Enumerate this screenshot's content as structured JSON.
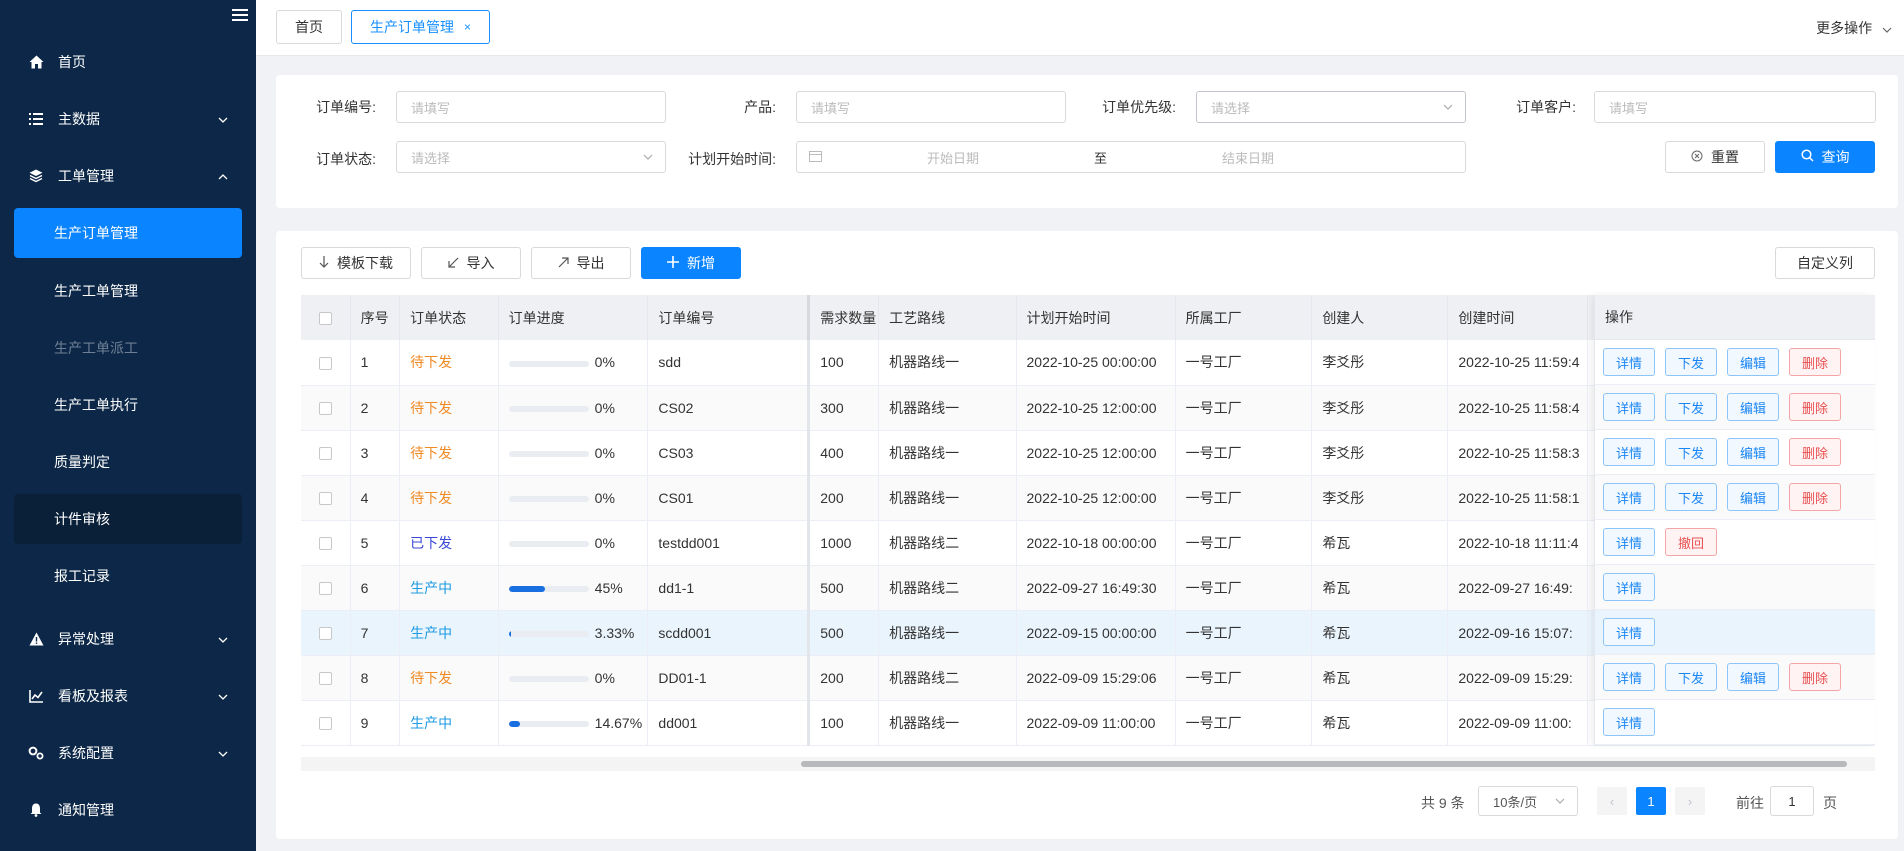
{
  "sidebar": {
    "menu": [
      {
        "label": "首页",
        "icon": "home-icon"
      },
      {
        "label": "主数据",
        "icon": "list-icon"
      },
      {
        "label": "工单管理",
        "icon": "layers-icon"
      },
      {
        "label": "异常处理",
        "icon": "warning-icon"
      },
      {
        "label": "看板及报表",
        "icon": "chart-icon"
      },
      {
        "label": "系统配置",
        "icon": "gears-icon"
      },
      {
        "label": "通知管理",
        "icon": "bell-icon"
      }
    ],
    "submenu": [
      {
        "label": "生产订单管理",
        "state": "active"
      },
      {
        "label": "生产工单管理",
        "state": "normal"
      },
      {
        "label": "生产工单派工",
        "state": "disabled"
      },
      {
        "label": "生产工单执行",
        "state": "normal"
      },
      {
        "label": "质量判定",
        "state": "normal"
      },
      {
        "label": "计件审核",
        "state": "hover"
      },
      {
        "label": "报工记录",
        "state": "normal"
      }
    ]
  },
  "tabs": [
    {
      "label": "首页"
    },
    {
      "label": "生产订单管理",
      "close": "×"
    }
  ],
  "more_ops": "更多操作",
  "filters": {
    "order_no": {
      "label": "订单编号:",
      "placeholder": "请填写"
    },
    "product": {
      "label": "产品:",
      "placeholder": "请填写"
    },
    "priority": {
      "label": "订单优先级:",
      "placeholder": "请选择"
    },
    "customer": {
      "label": "订单客户:",
      "placeholder": "请填写"
    },
    "status": {
      "label": "订单状态:",
      "placeholder": "请选择"
    },
    "start_time": {
      "label": "计划开始时间:",
      "start_placeholder": "开始日期",
      "separator": "至",
      "end_placeholder": "结束日期"
    },
    "reset_label": "重置",
    "query_label": "查询"
  },
  "toolbar": {
    "template_download": "模板下载",
    "import": "导入",
    "export": "导出",
    "add": "新增",
    "custom_columns": "自定义列"
  },
  "table": {
    "headers": [
      "序号",
      "订单状态",
      "订单进度",
      "订单编号",
      "需求数量",
      "工艺路线",
      "计划开始时间",
      "所属工厂",
      "创建人",
      "创建时间",
      "操作"
    ],
    "rows": [
      {
        "no": "1",
        "status": "待下发",
        "status_class": "st-orange",
        "progress": 0,
        "progress_text": "0%",
        "order_no": "sdd",
        "qty": "100",
        "route": "机器路线一",
        "plan_start": "2022-10-25 00:00:00",
        "factory": "一号工厂",
        "creator": "李爻彤",
        "created": "2022-10-25 11:59:4",
        "ops": [
          "详情",
          "下发",
          "编辑",
          "删除"
        ]
      },
      {
        "no": "2",
        "status": "待下发",
        "status_class": "st-orange",
        "progress": 0,
        "progress_text": "0%",
        "order_no": "CS02",
        "qty": "300",
        "route": "机器路线一",
        "plan_start": "2022-10-25 12:00:00",
        "factory": "一号工厂",
        "creator": "李爻彤",
        "created": "2022-10-25 11:58:4",
        "ops": [
          "详情",
          "下发",
          "编辑",
          "删除"
        ]
      },
      {
        "no": "3",
        "status": "待下发",
        "status_class": "st-orange",
        "progress": 0,
        "progress_text": "0%",
        "order_no": "CS03",
        "qty": "400",
        "route": "机器路线一",
        "plan_start": "2022-10-25 12:00:00",
        "factory": "一号工厂",
        "creator": "李爻彤",
        "created": "2022-10-25 11:58:3",
        "ops": [
          "详情",
          "下发",
          "编辑",
          "删除"
        ]
      },
      {
        "no": "4",
        "status": "待下发",
        "status_class": "st-orange",
        "progress": 0,
        "progress_text": "0%",
        "order_no": "CS01",
        "qty": "200",
        "route": "机器路线一",
        "plan_start": "2022-10-25 12:00:00",
        "factory": "一号工厂",
        "creator": "李爻彤",
        "created": "2022-10-25 11:58:1",
        "ops": [
          "详情",
          "下发",
          "编辑",
          "删除"
        ]
      },
      {
        "no": "5",
        "status": "已下发",
        "status_class": "st-blue",
        "progress": 0,
        "progress_text": "0%",
        "order_no": "testdd001",
        "qty": "1000",
        "route": "机器路线二",
        "plan_start": "2022-10-18 00:00:00",
        "factory": "一号工厂",
        "creator": "希瓦",
        "created": "2022-10-18 11:11:4",
        "ops": [
          "详情",
          "撤回"
        ]
      },
      {
        "no": "6",
        "status": "生产中",
        "status_class": "st-cyan",
        "progress": 0.45,
        "progress_text": "45%",
        "order_no": "dd1-1",
        "qty": "500",
        "route": "机器路线二",
        "plan_start": "2022-09-27 16:49:30",
        "factory": "一号工厂",
        "creator": "希瓦",
        "created": "2022-09-27 16:49:",
        "ops": [
          "详情"
        ]
      },
      {
        "no": "7",
        "status": "生产中",
        "status_class": "st-cyan",
        "progress": 0.0333,
        "progress_text": "3.33%",
        "order_no": "scdd001",
        "qty": "500",
        "route": "机器路线一",
        "plan_start": "2022-09-15 00:00:00",
        "factory": "一号工厂",
        "creator": "希瓦",
        "created": "2022-09-16 15:07:",
        "ops": [
          "详情"
        ]
      },
      {
        "no": "8",
        "status": "待下发",
        "status_class": "st-orange",
        "progress": 0,
        "progress_text": "0%",
        "order_no": "DD01-1",
        "qty": "200",
        "route": "机器路线二",
        "plan_start": "2022-09-09 15:29:06",
        "factory": "一号工厂",
        "creator": "希瓦",
        "created": "2022-09-09 15:29:",
        "ops": [
          "详情",
          "下发",
          "编辑",
          "删除"
        ]
      },
      {
        "no": "9",
        "status": "生产中",
        "status_class": "st-cyan",
        "progress": 0.1467,
        "progress_text": "14.67%",
        "order_no": "dd001",
        "qty": "100",
        "route": "机器路线一",
        "plan_start": "2022-09-09 11:00:00",
        "factory": "一号工厂",
        "creator": "希瓦",
        "created": "2022-09-09 11:00:",
        "ops": [
          "详情"
        ]
      }
    ]
  },
  "pagination": {
    "total": "共 9 条",
    "page_size": "10条/页",
    "current": "1",
    "goto_prefix": "前往",
    "goto_value": "1",
    "goto_suffix": "页",
    "prev": "‹",
    "next": "›"
  },
  "colors": {
    "sidebar_bg": "#0c2747",
    "primary": "#0a84ff",
    "status_pending": "#f08a24",
    "status_issued": "#3a48d6",
    "status_producing": "#1d9be3",
    "delete_red": "#e85050"
  }
}
